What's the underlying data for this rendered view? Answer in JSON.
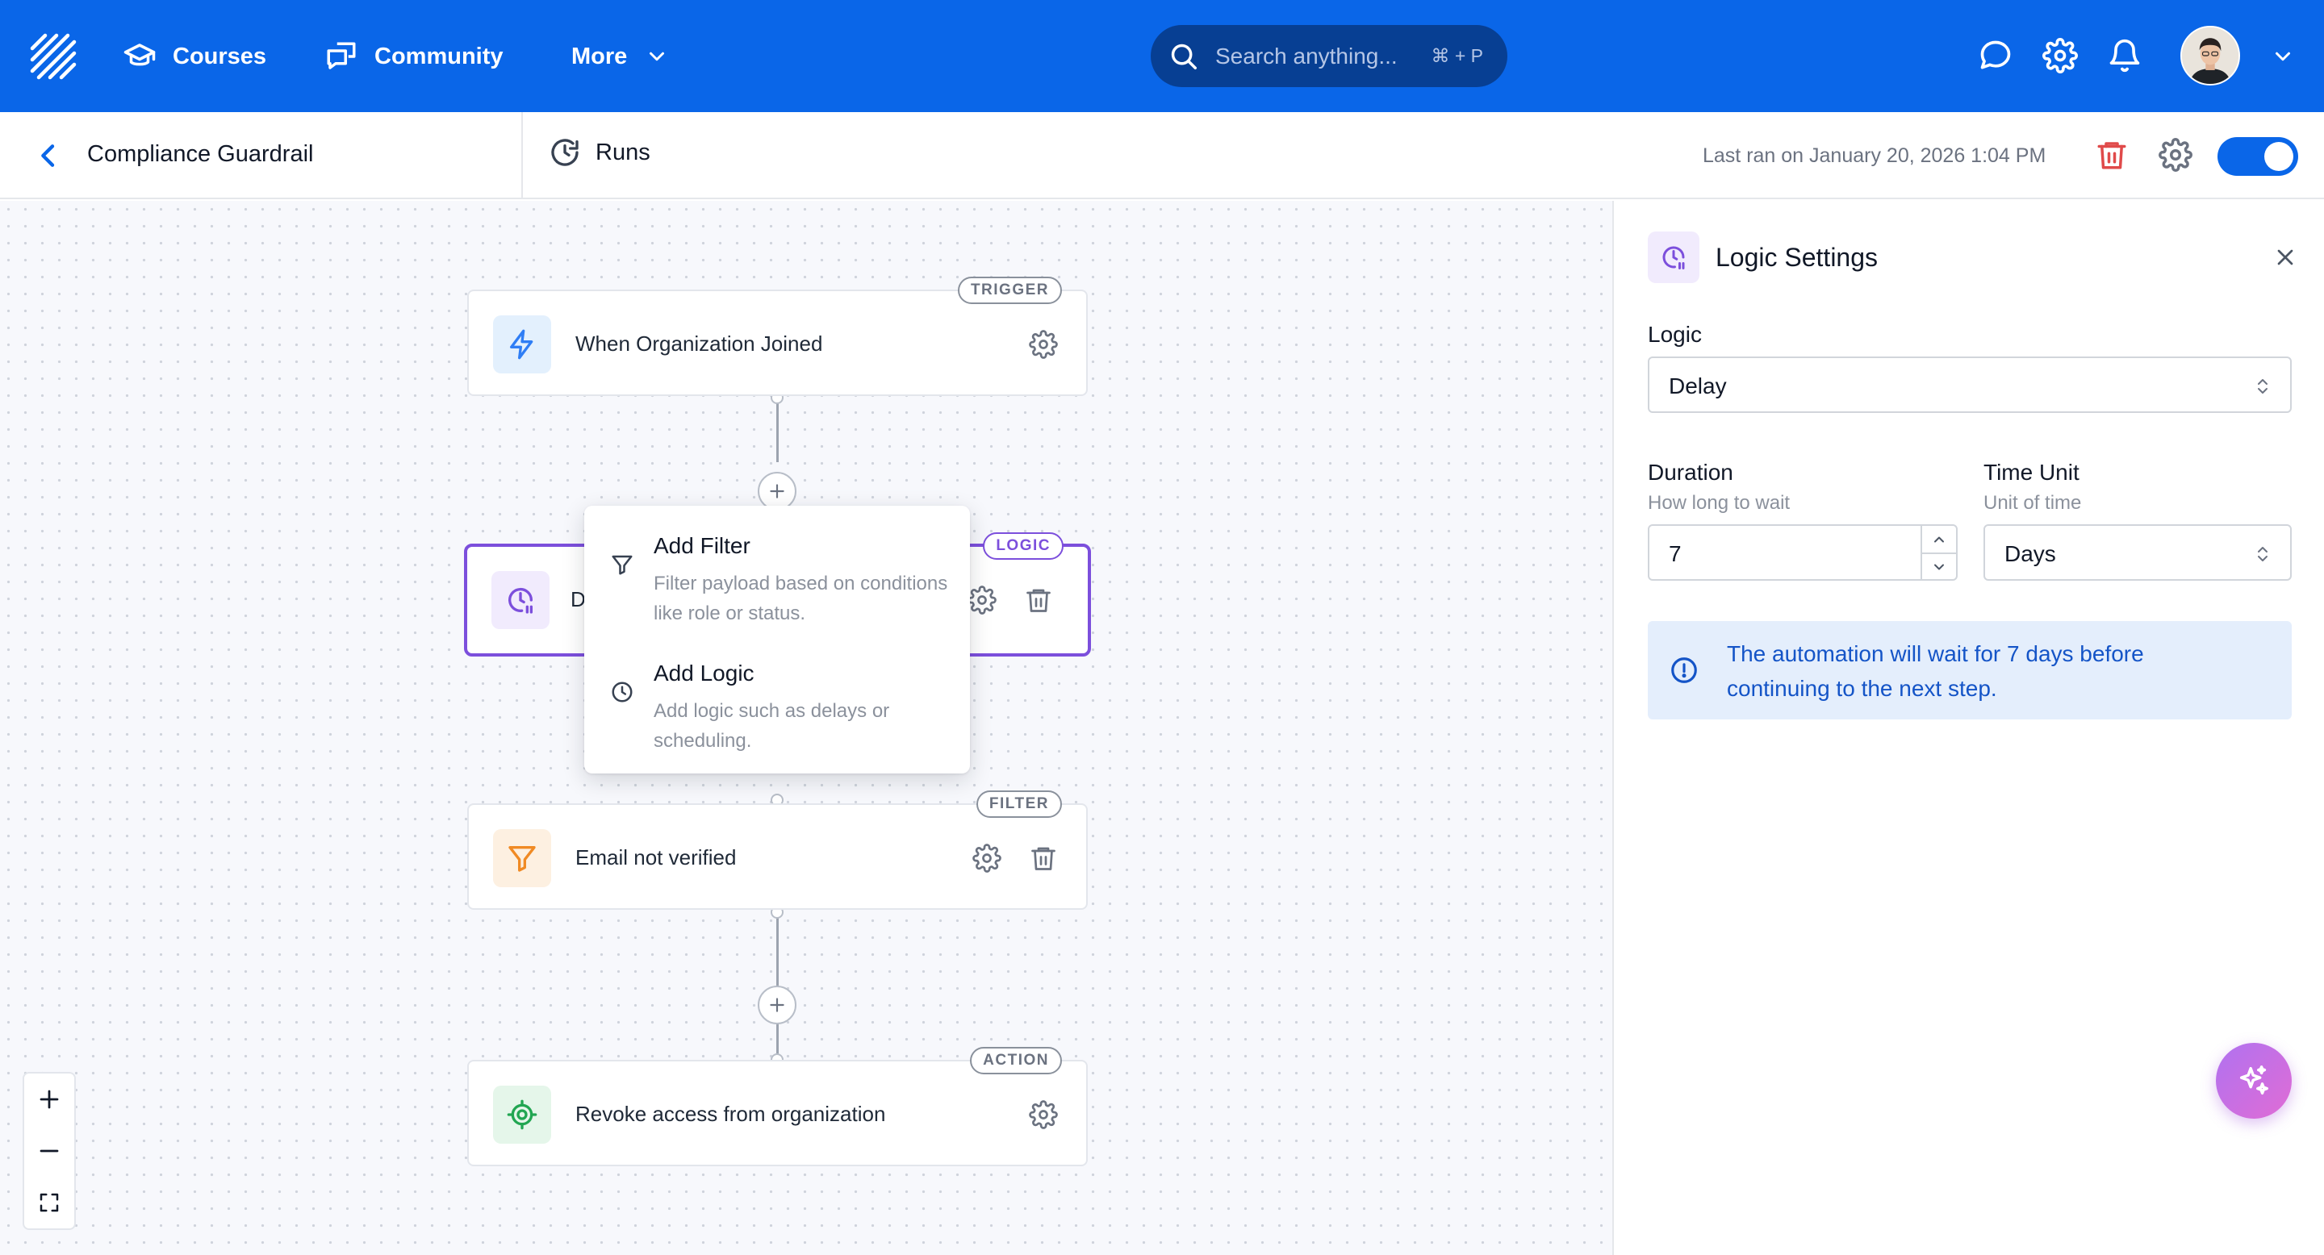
{
  "nav": {
    "courses": "Courses",
    "community": "Community",
    "more": "More",
    "search_placeholder": "Search anything...",
    "search_shortcut": "⌘ + P"
  },
  "subheader": {
    "workflow_name": "Compliance Guardrail",
    "runs": "Runs",
    "last_ran": "Last ran on January 20, 2026 1:04 PM",
    "enabled": true
  },
  "workflow": {
    "nodes": [
      {
        "badge": "TRIGGER",
        "label": "When Organization Joined",
        "icon": "lightning-icon"
      },
      {
        "badge": "LOGIC",
        "label": "D",
        "icon": "clock-pause-icon"
      },
      {
        "badge": "FILTER",
        "label": "Email not verified",
        "icon": "funnel-icon"
      },
      {
        "badge": "ACTION",
        "label": "Revoke access from organization",
        "icon": "target-icon"
      }
    ]
  },
  "popover": {
    "items": [
      {
        "title": "Add Filter",
        "description": "Filter payload based on conditions like role or status."
      },
      {
        "title": "Add Logic",
        "description": "Add logic such as delays or scheduling."
      }
    ]
  },
  "panel": {
    "title": "Logic Settings",
    "logic_label": "Logic",
    "logic_value": "Delay",
    "duration_label": "Duration",
    "duration_help": "How long to wait",
    "duration_value": "7",
    "unit_label": "Time Unit",
    "unit_help": "Unit of time",
    "unit_value": "Days",
    "info_text": "The automation will wait for 7 days before continuing to the next step."
  },
  "colors": {
    "brand": "#0a66e8",
    "logic": "#7c4fdc",
    "trigger": "#2f7ef5",
    "filter": "#f08a24",
    "action": "#22a652",
    "danger": "#e04a4a"
  }
}
